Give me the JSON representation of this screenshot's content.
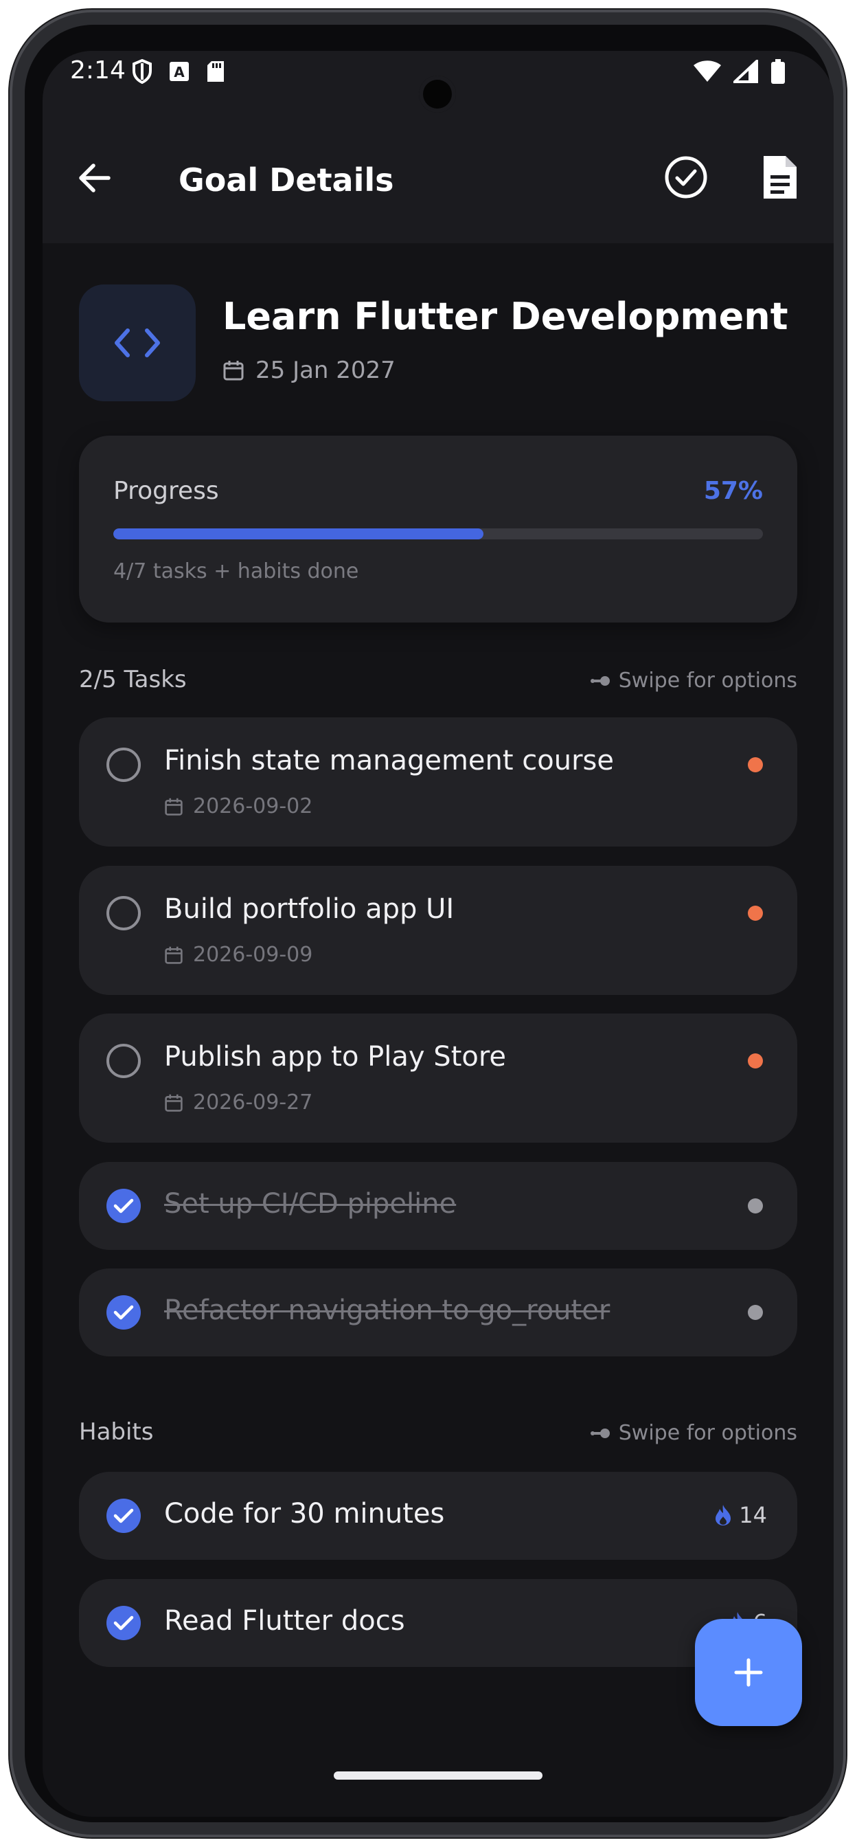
{
  "status_bar": {
    "time": "2:14",
    "icons_left": [
      "shield-icon",
      "a-box-icon",
      "sd-card-icon"
    ],
    "icons_right": [
      "wifi-icon",
      "signal-icon",
      "battery-icon"
    ]
  },
  "app_bar": {
    "title": "Goal Details",
    "actions": [
      "check-circle-icon",
      "document-icon"
    ]
  },
  "goal": {
    "icon": "code-icon",
    "title": "Learn Flutter Development",
    "date": "25 Jan 2027"
  },
  "progress": {
    "label": "Progress",
    "percent_text": "57%",
    "value": 0.57,
    "subtitle": "4/7 tasks + habits done"
  },
  "tasks_section": {
    "title": "2/5 Tasks",
    "hint": "Swipe for options"
  },
  "tasks": [
    {
      "title": "Finish state management course",
      "date": "2026-09-02",
      "done": false
    },
    {
      "title": "Build portfolio app UI",
      "date": "2026-09-09",
      "done": false
    },
    {
      "title": "Publish app to Play Store",
      "date": "2026-09-27",
      "done": false
    },
    {
      "title": "Set up CI/CD pipeline",
      "done": true
    },
    {
      "title": "Refactor navigation to go_router",
      "done": true
    }
  ],
  "habits_section": {
    "title": "Habits",
    "hint": "Swipe for options"
  },
  "habits": [
    {
      "title": "Code for 30 minutes",
      "streak": "14",
      "done": true
    },
    {
      "title": "Read Flutter docs",
      "streak": "6",
      "done": true
    }
  ],
  "colors": {
    "accent": "#4a6de6",
    "fab": "#5b8cff",
    "priority_high": "#f0744a",
    "priority_done": "#9a9aa0",
    "background": "#131316",
    "card": "#222226"
  },
  "fab": {
    "icon": "plus-icon"
  }
}
